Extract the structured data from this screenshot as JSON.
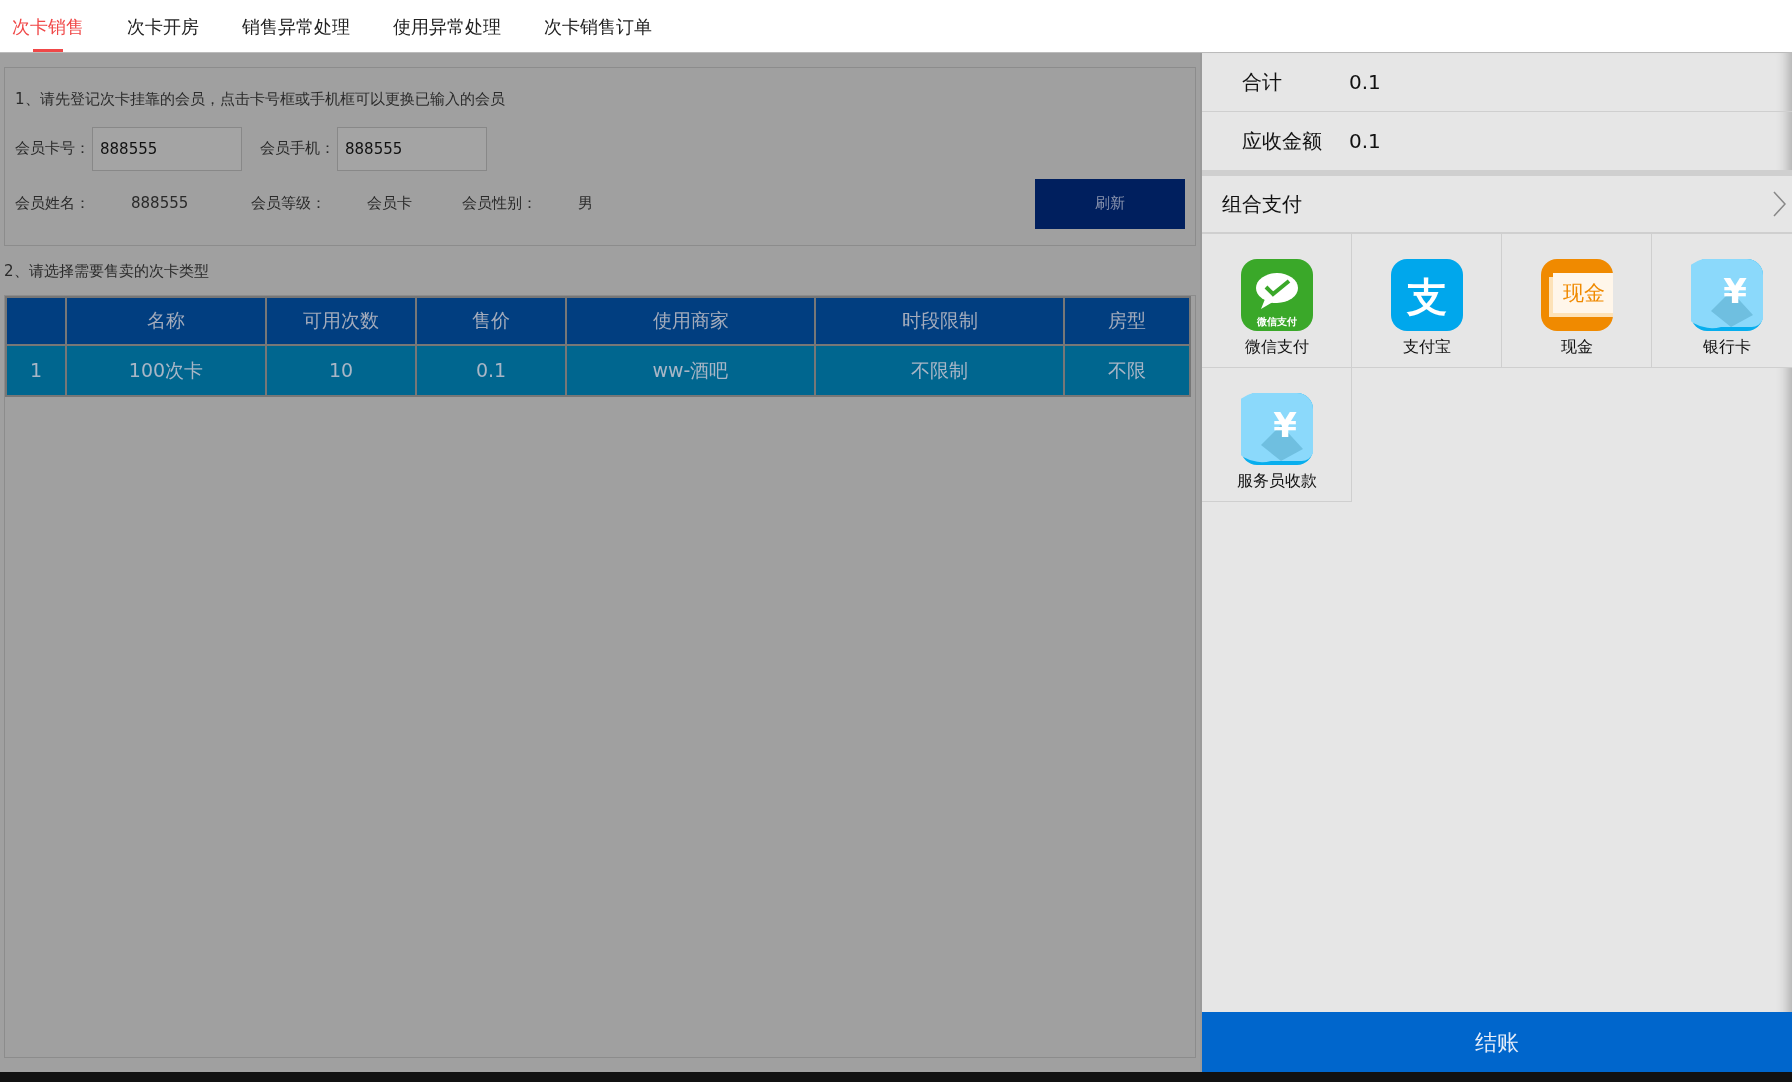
{
  "tabs": [
    {
      "label": "次卡销售",
      "selected": true
    },
    {
      "label": "次卡开房",
      "selected": false
    },
    {
      "label": "销售异常处理",
      "selected": false
    },
    {
      "label": "使用异常处理",
      "selected": false
    },
    {
      "label": "次卡销售订单",
      "selected": false
    }
  ],
  "member_section": {
    "instruction": "1、请先登记次卡挂靠的会员，点击卡号框或手机框可以更换已输入的会员",
    "fields": [
      {
        "label": "会员卡号：",
        "value": "888555"
      },
      {
        "label": "会员手机：",
        "value": "888555"
      }
    ],
    "info": [
      {
        "label": "会员姓名：",
        "value": "888555"
      },
      {
        "label": "会员等级：",
        "value": "会员卡"
      },
      {
        "label": "会员性别：",
        "value": "男"
      }
    ],
    "refresh_button": "刷新"
  },
  "card_section": {
    "instruction": "2、请选择需要售卖的次卡类型",
    "columns": [
      "",
      "名称",
      "可用次数",
      "售价",
      "使用商家",
      "时段限制",
      "房型"
    ],
    "rows": [
      {
        "cells": [
          "1",
          "100次卡",
          "10",
          "0.1",
          "ww-酒吧",
          "不限制",
          "不限"
        ],
        "selected": true
      }
    ]
  },
  "summary": [
    {
      "label": "合计",
      "value": "0.1"
    },
    {
      "label": "应收金额",
      "value": "0.1"
    }
  ],
  "combo_payment": "组合支付",
  "payment_methods": [
    {
      "kind": "wechat",
      "icon_text": "微信支付",
      "label": "微信支付"
    },
    {
      "kind": "alipay",
      "icon_text": "支",
      "label": "支付宝"
    },
    {
      "kind": "cash",
      "icon_text": "现金",
      "label": "现金"
    },
    {
      "kind": "bank",
      "icon_text": "¥",
      "label": "银行卡"
    },
    {
      "kind": "bank",
      "icon_text": "¥",
      "label": "服务员收款"
    }
  ],
  "checkout_button": "结账"
}
